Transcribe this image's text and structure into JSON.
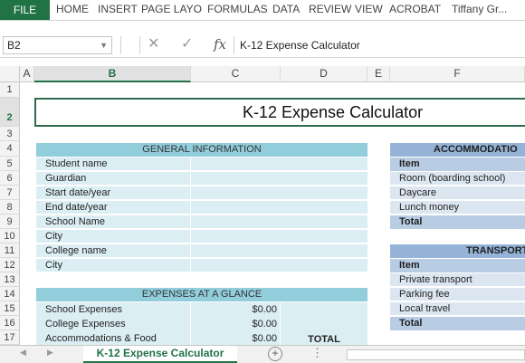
{
  "ribbon": {
    "file_tab": "FILE",
    "tabs": [
      "HOME",
      "INSERT",
      "PAGE LAYO",
      "FORMULAS",
      "DATA",
      "REVIEW",
      "VIEW",
      "ACROBAT"
    ],
    "user": "Tiffany Gr..."
  },
  "formula_bar": {
    "name_box": "B2",
    "fx_label": "fx",
    "content": "K-12 Expense Calculator"
  },
  "columns": [
    "A",
    "B",
    "C",
    "D",
    "E",
    "F"
  ],
  "rows": [
    "1",
    "2",
    "3",
    "4",
    "5",
    "6",
    "7",
    "8",
    "9",
    "10",
    "11",
    "12",
    "13",
    "14",
    "15",
    "16",
    "17"
  ],
  "sheet": {
    "title": "K-12 Expense Calculator",
    "general_information": {
      "header": "GENERAL INFORMATION",
      "fields": [
        "Student name",
        "Guardian",
        "Start date/year",
        "End date/year",
        "School Name",
        "City",
        "College name",
        "City"
      ]
    },
    "expenses": {
      "header": "EXPENSES AT A GLANCE",
      "items": [
        {
          "label": "School Expenses",
          "value": "$0.00"
        },
        {
          "label": "College Expenses",
          "value": "$0.00"
        },
        {
          "label": "Accommodations & Food",
          "value": "$0.00"
        }
      ],
      "total_label": "TOTAL"
    },
    "accommodation": {
      "header": "ACCOMMODATIO",
      "item_header": "Item",
      "items": [
        "Room (boarding school)",
        "Daycare",
        "Lunch money"
      ],
      "total": "Total"
    },
    "transport": {
      "header": "TRANSPORT",
      "item_header": "Item",
      "items": [
        "Private transport",
        "Parking fee",
        "Local travel"
      ],
      "total": "Total"
    }
  },
  "sheet_tabs": {
    "active": "K-12 Expense Calculator"
  },
  "colors": {
    "excel_green": "#217346",
    "section_teal": "#92cddc",
    "cell_teal": "#dbeef3",
    "section_blue": "#95b3d7",
    "cell_blue": "#dce6f1"
  }
}
